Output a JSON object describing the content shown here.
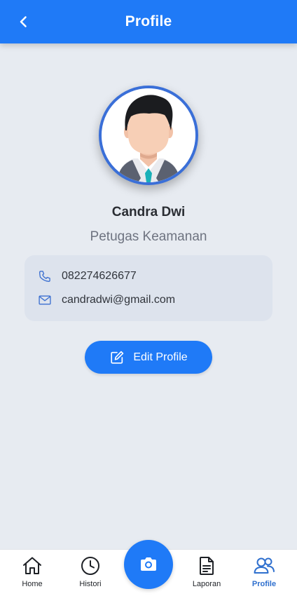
{
  "header": {
    "title": "Profile",
    "back_icon": "chevron-left-icon"
  },
  "profile": {
    "name": "Candra Dwi",
    "role": "Petugas Keamanan",
    "phone": "082274626677",
    "email": "candradwi@gmail.com"
  },
  "actions": {
    "edit_label": "Edit Profile"
  },
  "bottom_nav": {
    "items": [
      {
        "label": "Home",
        "icon": "home-icon"
      },
      {
        "label": "Histori",
        "icon": "clock-icon"
      },
      {
        "label": "Laporan",
        "icon": "document-icon"
      },
      {
        "label": "Profile",
        "icon": "users-icon",
        "active": true
      }
    ],
    "center_icon": "camera-icon"
  },
  "colors": {
    "primary": "#1f7af7",
    "background": "#e7ebf1",
    "active_nav": "#2e6fce"
  }
}
